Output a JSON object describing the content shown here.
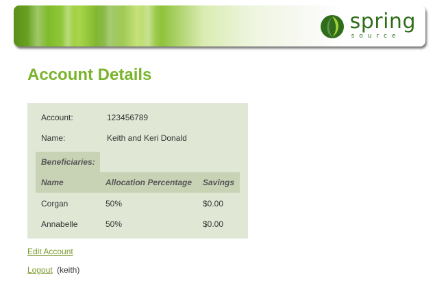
{
  "brand": {
    "word": "spring",
    "sub": "source"
  },
  "page": {
    "title": "Account Details"
  },
  "account": {
    "account_label": "Account:",
    "account_value": "123456789",
    "name_label": "Name:",
    "name_value": "Keith and Keri Donald"
  },
  "beneficiaries": {
    "header": "Beneficiaries:",
    "columns": [
      "Name",
      "Allocation Percentage",
      "Savings"
    ],
    "rows": [
      {
        "name": "Corgan",
        "allocation": "50%",
        "savings": "$0.00"
      },
      {
        "name": "Annabelle",
        "allocation": "50%",
        "savings": "$0.00"
      }
    ]
  },
  "actions": {
    "edit_account": "Edit Account",
    "logout": "Logout",
    "user": "(keith)"
  },
  "colors": {
    "title": "#7ab42c",
    "panel_bg": "#e0e8d5",
    "header_bg": "#c8d3b6",
    "link": "#7a9a2c",
    "logo": "#2f6d1a"
  }
}
